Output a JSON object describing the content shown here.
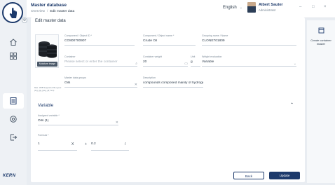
{
  "header": {
    "title": "Master database",
    "breadcrumb": [
      "Overview",
      "Edit master data"
    ],
    "language": "English",
    "user_name": "Albert Sauter",
    "user_role": "Administrator",
    "win_min": "–",
    "win_max": "□",
    "win_close": "×"
  },
  "brand": "KERN",
  "main": {
    "title": "Edit master data",
    "photo_button": "Moisture image",
    "photo_note": "Max. 2MB Supported file types: png, jpg, jpeg, gif, bmp"
  },
  "fields": {
    "component_id": {
      "label": "Component / Object ID *",
      "value": "CO800700907"
    },
    "component_name": {
      "label": "Component / Object name *",
      "value": "Crude Oil"
    },
    "grouping_name": {
      "label": "Grouping name / Name",
      "value": "CLONE701809"
    },
    "container": {
      "label": "Container",
      "placeholder": "Please select or enter the container"
    },
    "container_weight": {
      "label": "Container weight",
      "value": "20"
    },
    "unit": {
      "label": "Unit",
      "value": "g"
    },
    "weight_evaluation": {
      "label": "Weight evaluation",
      "value": "Variable"
    },
    "master_data_groups": {
      "label": "Master data groups",
      "value": "Oils"
    },
    "description": {
      "label": "Description",
      "value": "compounds composed mainly of hydrogen and c"
    }
  },
  "variable_section": {
    "title": "Variable",
    "assigned_variable": {
      "label": "Assigned variable *",
      "value": "Oils (1)"
    },
    "formula_label": "Formula *",
    "formula": {
      "operand1": "1",
      "op1": "X",
      "op2": "+",
      "operand2": "0.2",
      "op3": "/"
    }
  },
  "right_panel": {
    "create_label": "Create container master"
  },
  "buttons": {
    "back": "Back",
    "update": "Update"
  },
  "colors": {
    "brand": "#1d3a6b",
    "background": "#e9edf2"
  }
}
